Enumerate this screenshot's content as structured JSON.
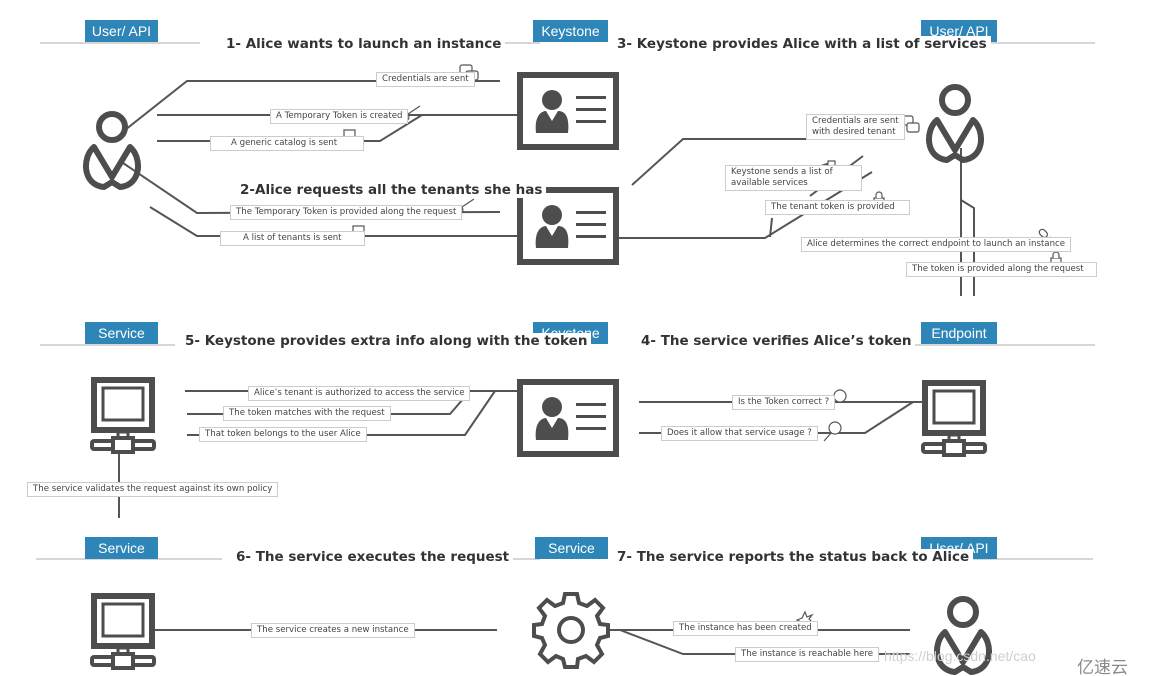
{
  "colors": {
    "tag": "#2e86b8",
    "line": "#555555",
    "icon": "#4d4d4d"
  },
  "tags": {
    "r1_left": "User/ API",
    "r1_mid": "Keystone",
    "r1_right": "User/ API",
    "r2_left": "Service",
    "r2_mid": "Keystone",
    "r2_right": "Endpoint",
    "r3_left": "Service",
    "r3_mid": "Service",
    "r3_right": "User/ API"
  },
  "titles": {
    "step1": "1- Alice wants to launch an instance",
    "step2": "2-Alice requests all the tenants she has",
    "step3": "3- Keystone provides Alice with a list of services",
    "step4": "4- The service verifies Alice’s token",
    "step5": "5- Keystone provides extra info along with the token",
    "step6": "6- The service executes the request",
    "step7": "7- The service reports the status back to Alice"
  },
  "labels": {
    "credentials_sent": "Credentials are sent",
    "temp_token_created": "A Temporary Token is created",
    "generic_catalog": "A generic catalog is sent",
    "temp_token_provided": "The Temporary Token is provided along the request",
    "tenants_list": "A list of tenants is sent",
    "cred_tenant_1": "Credentials are sent",
    "cred_tenant_2": "with desired tenant",
    "services_list_1": "Keystone sends a list of",
    "services_list_2": "available services",
    "tenant_token": "The tenant token is provided",
    "endpoint_choice": "Alice determines the correct endpoint to launch an instance",
    "token_along": "The token is provided along the request",
    "tenant_authorized": "Alice’s tenant is authorized to access the service",
    "token_matches": "The token matches with the request",
    "token_belongs": "That token belongs to the user Alice",
    "validates_policy": "The service validates the request against its own policy",
    "token_correct": "Is the Token correct ?",
    "service_usage": "Does it allow that service usage ?",
    "creates_instance": "The service creates a new instance",
    "instance_created": "The instance has been created",
    "instance_reachable": "The instance is reachable here"
  },
  "watermark": "https://blog.csdn.net/cao",
  "logo": "亿速云"
}
